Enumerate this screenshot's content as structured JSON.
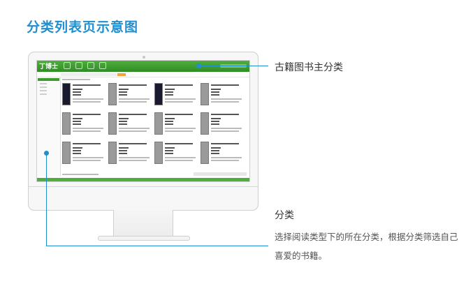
{
  "title": "分类列表页示意图",
  "screen": {
    "logo": "丁博士"
  },
  "callouts": {
    "main_category": "古籍图书主分类",
    "category_title": "分类",
    "category_desc": "选择阅读类型下的所在分类，根据分类筛选自己喜爱的书籍。"
  },
  "colors": {
    "accent": "#1f8fd0",
    "brand_green": "#3d9c2e",
    "search_button": "#f2a536"
  }
}
